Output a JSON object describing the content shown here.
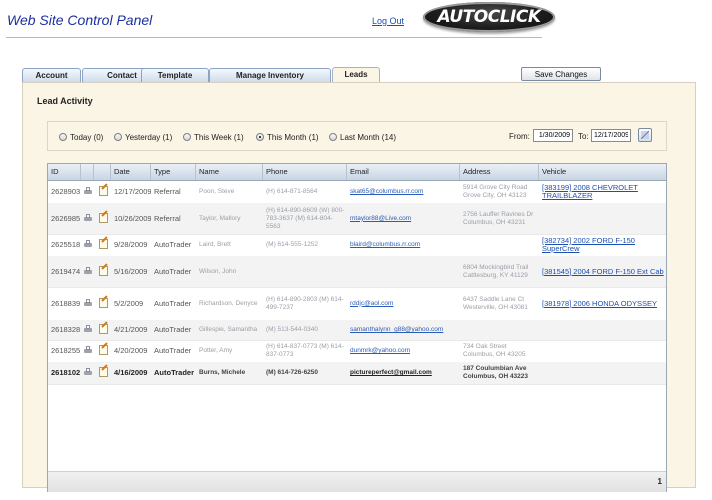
{
  "header": {
    "title": "Web Site Control Panel",
    "logout_label": "Log Out",
    "logo_text": "AUTOCLICK"
  },
  "tabs": [
    {
      "label": "Account"
    },
    {
      "label": "Contact"
    },
    {
      "label": "Template"
    },
    {
      "label": "Manage Inventory"
    },
    {
      "label": "Leads",
      "active": true
    }
  ],
  "toolbar": {
    "save_label": "Save Changes"
  },
  "leads": {
    "title": "Lead Activity",
    "filters": [
      {
        "label": "Today (0)",
        "selected": false
      },
      {
        "label": "Yesterday (1)",
        "selected": false
      },
      {
        "label": "This Week (1)",
        "selected": false
      },
      {
        "label": "This Month (1)",
        "selected": true
      },
      {
        "label": "Last Month (14)",
        "selected": false
      }
    ],
    "from_label": "From:",
    "from_value": "1/30/2009",
    "to_label": "To:",
    "to_value": "12/17/2009",
    "columns": [
      "ID",
      "",
      "",
      "Date",
      "Type",
      "Name",
      "Phone",
      "Email",
      "Address",
      "Vehicle"
    ],
    "rows": [
      {
        "id": "2628903",
        "date": "12/17/2009",
        "type": "Referral",
        "name": "Poon, Steve",
        "phone": "(H) 614-871-8564",
        "email": "skat65@columbus.rr.com",
        "address": "5914 Grove City Road Grove City, OH 43123",
        "vehicle": "[383199] 2008 CHEVROLET TRAILBLAZER"
      },
      {
        "id": "2626985",
        "date": "10/26/2009",
        "type": "Referral",
        "name": "Taylor, Mallory",
        "phone": "(H) 614-890-8609 (W) 800-783-3637 (M) 614-804-5563",
        "email": "mtaylor88@Live.com",
        "address": "2756 Lauffer Ravines Dr Columbus, OH 43231",
        "vehicle": ""
      },
      {
        "id": "2625518",
        "date": "9/28/2009",
        "type": "AutoTrader",
        "name": "Laird, Brett",
        "phone": "(M) 614-555-1252",
        "email": "blaird@columbus.rr.com",
        "address": "",
        "vehicle": "[382734] 2002 FORD F-150 SuperCrew"
      },
      {
        "id": "2619474",
        "date": "5/16/2009",
        "type": "AutoTrader",
        "name": "Wilson, John",
        "phone": "",
        "email": "",
        "address": "6804 Mockingbird Trail Cattlesburg, KY 41129",
        "vehicle": "[381545] 2004 FORD F-150 Ext Cab"
      },
      {
        "id": "2618839",
        "date": "5/2/2009",
        "type": "AutoTrader",
        "name": "Richardson, Denyce",
        "phone": "(H) 614-890-2803 (M) 614-499-7237",
        "email": "rddjc@aol.com",
        "address": "6437 Saddle Lane Ct Westerville, OH 43081",
        "vehicle": "[381978] 2006 HONDA ODYSSEY"
      },
      {
        "id": "2618328",
        "date": "4/21/2009",
        "type": "AutoTrader",
        "name": "Gillespie, Samantha",
        "phone": "(M) 513-544-0340",
        "email": "samanthalynn_g88@yahoo.com",
        "address": "",
        "vehicle": ""
      },
      {
        "id": "2618255",
        "date": "4/20/2009",
        "type": "AutoTrader",
        "name": "Potter, Amy",
        "phone": "(H) 614-837-0773 (M) 614-837-0773",
        "email": "dunmrk@yahoo.com",
        "address": "734 Oak Street Columbus, OH 43205",
        "vehicle": ""
      },
      {
        "id": "2618102",
        "date": "4/16/2009",
        "type": "AutoTrader",
        "name": "Burns, Michele",
        "phone": "(M) 614-726-6250",
        "email": "pictureperfect@gmail.com",
        "address": "187 Coulumbian Ave Columbus, OH 43223",
        "vehicle": ""
      }
    ],
    "page_number": "1"
  }
}
